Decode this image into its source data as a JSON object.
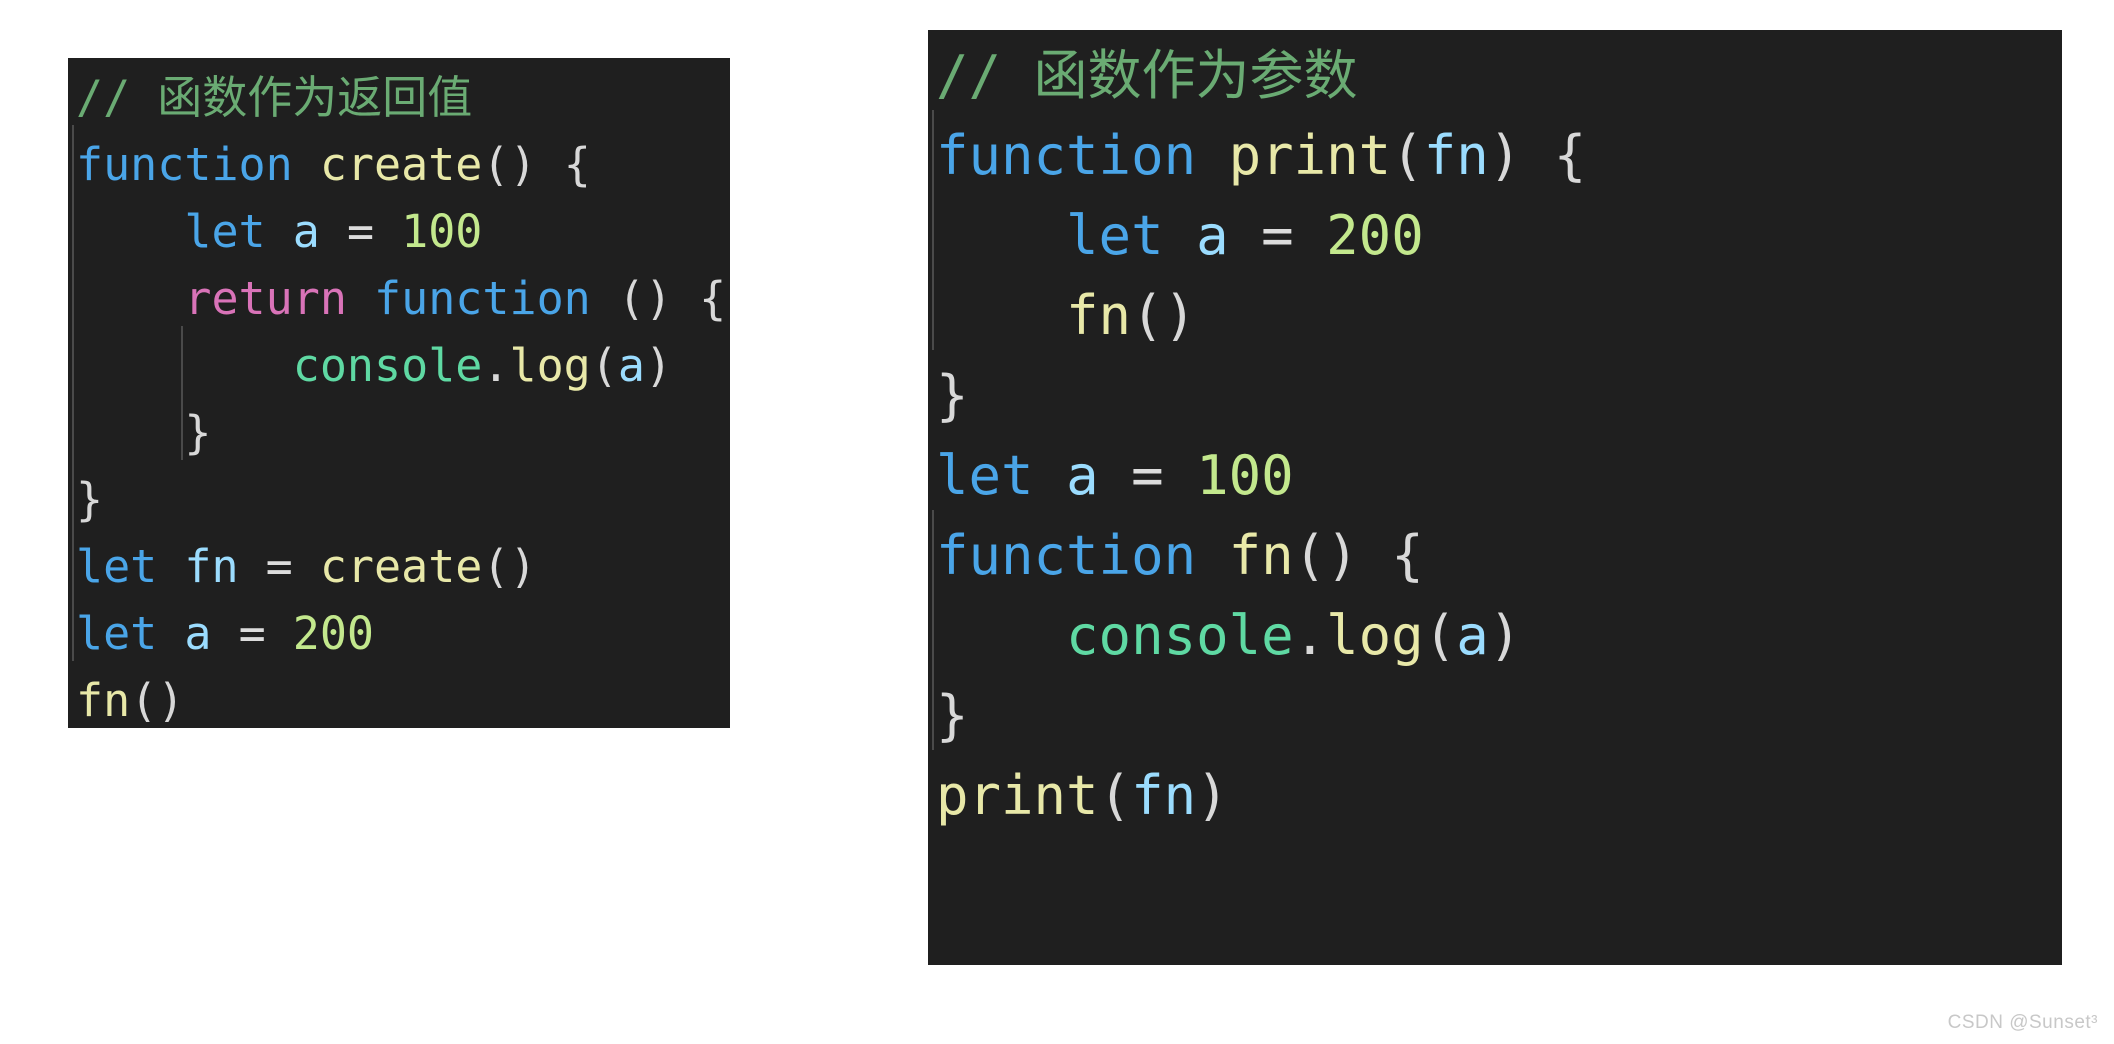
{
  "background_color": "#ffffff",
  "panels": [
    {
      "id": "left",
      "name": "code-block-function-as-return-value",
      "background_color": "#1f1f1f",
      "lines": [
        {
          "tokens": [
            {
              "t": "// 函数作为返回值",
              "c": "comment"
            }
          ]
        },
        {
          "tokens": [
            {
              "t": "function",
              "c": "keyword"
            },
            {
              "t": " ",
              "c": "plain"
            },
            {
              "t": "create",
              "c": "func"
            },
            {
              "t": "()",
              "c": "punct"
            },
            {
              "t": " ",
              "c": "plain"
            },
            {
              "t": "{",
              "c": "punct"
            }
          ]
        },
        {
          "tokens": [
            {
              "t": "    ",
              "c": "plain"
            },
            {
              "t": "let",
              "c": "keyword"
            },
            {
              "t": " ",
              "c": "plain"
            },
            {
              "t": "a",
              "c": "var"
            },
            {
              "t": " ",
              "c": "plain"
            },
            {
              "t": "=",
              "c": "op"
            },
            {
              "t": " ",
              "c": "plain"
            },
            {
              "t": "100",
              "c": "num"
            }
          ]
        },
        {
          "tokens": [
            {
              "t": "    ",
              "c": "plain"
            },
            {
              "t": "return",
              "c": "return"
            },
            {
              "t": " ",
              "c": "plain"
            },
            {
              "t": "function",
              "c": "keyword"
            },
            {
              "t": " ",
              "c": "plain"
            },
            {
              "t": "()",
              "c": "punct"
            },
            {
              "t": " ",
              "c": "plain"
            },
            {
              "t": "{",
              "c": "punct"
            }
          ]
        },
        {
          "tokens": [
            {
              "t": "        ",
              "c": "plain"
            },
            {
              "t": "console",
              "c": "object"
            },
            {
              "t": ".",
              "c": "punct"
            },
            {
              "t": "log",
              "c": "func"
            },
            {
              "t": "(",
              "c": "punct"
            },
            {
              "t": "a",
              "c": "var"
            },
            {
              "t": ")",
              "c": "punct"
            }
          ]
        },
        {
          "tokens": [
            {
              "t": "    ",
              "c": "plain"
            },
            {
              "t": "}",
              "c": "punct"
            }
          ]
        },
        {
          "tokens": [
            {
              "t": "}",
              "c": "punct"
            }
          ]
        },
        {
          "tokens": [
            {
              "t": "let",
              "c": "keyword"
            },
            {
              "t": " ",
              "c": "plain"
            },
            {
              "t": "fn",
              "c": "var"
            },
            {
              "t": " ",
              "c": "plain"
            },
            {
              "t": "=",
              "c": "op"
            },
            {
              "t": " ",
              "c": "plain"
            },
            {
              "t": "create",
              "c": "func"
            },
            {
              "t": "()",
              "c": "punct"
            }
          ]
        },
        {
          "tokens": [
            {
              "t": "let",
              "c": "keyword"
            },
            {
              "t": " ",
              "c": "plain"
            },
            {
              "t": "a",
              "c": "var"
            },
            {
              "t": " ",
              "c": "plain"
            },
            {
              "t": "=",
              "c": "op"
            },
            {
              "t": " ",
              "c": "plain"
            },
            {
              "t": "200",
              "c": "num"
            }
          ]
        },
        {
          "tokens": [
            {
              "t": "fn",
              "c": "func"
            },
            {
              "t": "()",
              "c": "punct"
            }
          ]
        }
      ],
      "plain_text": "// 函数作为返回值\nfunction create() {\n    let a = 100\n    return function () {\n        console.log(a)\n    }\n}\nlet fn = create()\nlet a = 200\nfn()"
    },
    {
      "id": "right",
      "name": "code-block-function-as-parameter",
      "background_color": "#1f1f1f",
      "lines": [
        {
          "tokens": [
            {
              "t": "// 函数作为参数",
              "c": "comment"
            }
          ]
        },
        {
          "tokens": [
            {
              "t": "function",
              "c": "keyword"
            },
            {
              "t": " ",
              "c": "plain"
            },
            {
              "t": "print",
              "c": "func"
            },
            {
              "t": "(",
              "c": "punct"
            },
            {
              "t": "fn",
              "c": "var"
            },
            {
              "t": ")",
              "c": "punct"
            },
            {
              "t": " ",
              "c": "plain"
            },
            {
              "t": "{",
              "c": "punct"
            }
          ]
        },
        {
          "tokens": [
            {
              "t": "    ",
              "c": "plain"
            },
            {
              "t": "let",
              "c": "keyword"
            },
            {
              "t": " ",
              "c": "plain"
            },
            {
              "t": "a",
              "c": "var"
            },
            {
              "t": " ",
              "c": "plain"
            },
            {
              "t": "=",
              "c": "op"
            },
            {
              "t": " ",
              "c": "plain"
            },
            {
              "t": "200",
              "c": "num"
            }
          ]
        },
        {
          "tokens": [
            {
              "t": "    ",
              "c": "plain"
            },
            {
              "t": "fn",
              "c": "func"
            },
            {
              "t": "()",
              "c": "punct"
            }
          ]
        },
        {
          "tokens": [
            {
              "t": "}",
              "c": "punct"
            }
          ]
        },
        {
          "tokens": [
            {
              "t": "let",
              "c": "keyword"
            },
            {
              "t": " ",
              "c": "plain"
            },
            {
              "t": "a",
              "c": "var"
            },
            {
              "t": " ",
              "c": "plain"
            },
            {
              "t": "=",
              "c": "op"
            },
            {
              "t": " ",
              "c": "plain"
            },
            {
              "t": "100",
              "c": "num"
            }
          ]
        },
        {
          "tokens": [
            {
              "t": "function",
              "c": "keyword"
            },
            {
              "t": " ",
              "c": "plain"
            },
            {
              "t": "fn",
              "c": "func"
            },
            {
              "t": "()",
              "c": "punct"
            },
            {
              "t": " ",
              "c": "plain"
            },
            {
              "t": "{",
              "c": "punct"
            }
          ]
        },
        {
          "tokens": [
            {
              "t": "    ",
              "c": "plain"
            },
            {
              "t": "console",
              "c": "object"
            },
            {
              "t": ".",
              "c": "punct"
            },
            {
              "t": "log",
              "c": "func"
            },
            {
              "t": "(",
              "c": "punct"
            },
            {
              "t": "a",
              "c": "var"
            },
            {
              "t": ")",
              "c": "punct"
            }
          ]
        },
        {
          "tokens": [
            {
              "t": "}",
              "c": "punct"
            }
          ]
        },
        {
          "tokens": [
            {
              "t": "print",
              "c": "func"
            },
            {
              "t": "(",
              "c": "punct"
            },
            {
              "t": "fn",
              "c": "var"
            },
            {
              "t": ")",
              "c": "punct"
            }
          ]
        }
      ],
      "plain_text": "// 函数作为参数\nfunction print(fn) {\n    let a = 200\n    fn()\n}\nlet a = 100\nfunction fn() {\n    console.log(a)\n}\nprint(fn)"
    }
  ],
  "syntax_colors": {
    "comment": "#6aab73",
    "keyword": "#4aa5e8",
    "function_name": "#e8e8a8",
    "variable": "#9bdcfe",
    "number": "#c3e88d",
    "punctuation": "#d8d8d8",
    "return_keyword": "#d973b8",
    "object": "#5fd9a3",
    "operator": "#dcdcdc"
  },
  "watermark": {
    "text": "CSDN @Sunset³"
  }
}
